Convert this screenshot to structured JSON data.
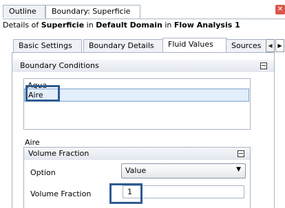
{
  "editor_tabs": [
    "Outline",
    "Boundary: Superficie"
  ],
  "details": {
    "prefix": "Details of ",
    "object": "Superficie",
    "mid1": " in ",
    "domain": "Default Domain",
    "mid2": " in ",
    "analysis": "Flow Analysis 1"
  },
  "tabs": [
    "Basic Settings",
    "Boundary Details",
    "Fluid Values",
    "Sources"
  ],
  "active_tab": "Fluid Values",
  "boundary_conditions": {
    "header": "Boundary Conditions",
    "items": [
      "Agua",
      "Aire"
    ],
    "selected": "Aire"
  },
  "selected_fluid_label": "Aire",
  "volume_fraction_section": {
    "header": "Volume Fraction",
    "option_label": "Option",
    "option_value": "Value",
    "field_label": "Volume Fraction",
    "field_value": "1"
  },
  "colors": {
    "highlight_border": "#2d5b91",
    "selection_bg": "#e3eefc",
    "panel_border": "#a9b4c4"
  },
  "icons": [
    "close-icon",
    "scroll-left-icon",
    "scroll-right-icon",
    "collapse-icon",
    "chevron-down-icon"
  ]
}
